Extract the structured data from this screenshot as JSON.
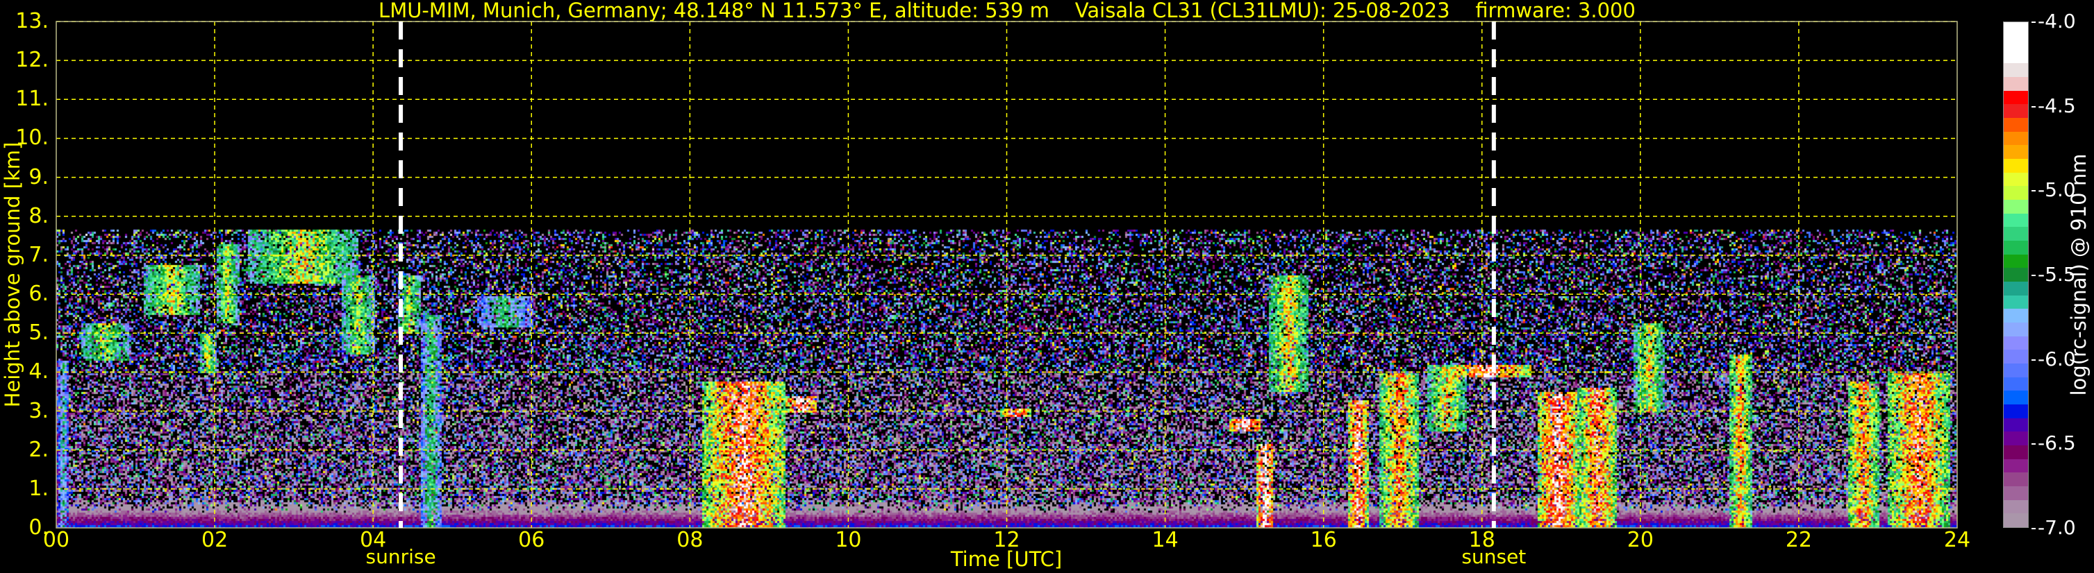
{
  "chart_data": {
    "type": "heatmap",
    "title": "LMU-MIM, Munich, Germany; 48.148° N 11.573° E, altitude: 539 m    Vaisala CL31 (CL31LMU): 25-08-2023    firmware: 3.000",
    "xlabel": "Time [UTC]",
    "ylabel": "Height above ground [km]",
    "xlim": [
      0,
      24
    ],
    "ylim": [
      0,
      13
    ],
    "x_ticks": [
      "00",
      "02",
      "04",
      "06",
      "08",
      "10",
      "12",
      "14",
      "16",
      "18",
      "20",
      "22",
      "24"
    ],
    "y_ticks": [
      "0.",
      "1.",
      "2.",
      "3.",
      "4.",
      "5.",
      "6.",
      "7.",
      "8.",
      "9.",
      "10.",
      "11.",
      "12.",
      "13."
    ],
    "grid": true,
    "annotations": [
      {
        "label": "sunrise",
        "time": 4.35
      },
      {
        "label": "sunset",
        "time": 18.15
      }
    ],
    "colorbar": {
      "label": "log(rc-signal) @ 910 nm",
      "range": [
        -7.0,
        -4.0
      ],
      "ticks": [
        "-4.0",
        "-4.5",
        "-5.0",
        "-5.5",
        "-6.0",
        "-6.5",
        "-7.0"
      ],
      "colors_bottom_to_top": [
        "#aa96aa",
        "#aa8caa",
        "#a0649b",
        "#96468c",
        "#8c1e8c",
        "#780064",
        "#6e0096",
        "#4b00b4",
        "#0014e6",
        "#0064ff",
        "#3c6eff",
        "#5a78ff",
        "#7882ff",
        "#8c8cff",
        "#8caaff",
        "#82beff",
        "#32c8aa",
        "#1ea58c",
        "#148c32",
        "#14a514",
        "#1ebe55",
        "#32d27d",
        "#46eb96",
        "#8cff78",
        "#c8ff3c",
        "#e6ff32",
        "#ffe600",
        "#ffaa00",
        "#ff8c00",
        "#ff5a00",
        "#f02020",
        "#ff0000",
        "#f0c3c3",
        "#ebe1e1",
        "#ffffff",
        "#ffffff",
        "#ffffff"
      ]
    },
    "signal_top_km": 7.7,
    "boundary_layer_km": 0.4,
    "features": [
      {
        "t0": 0.0,
        "t1": 0.15,
        "z0": 0.0,
        "z1": 4.3,
        "v": -5.6
      },
      {
        "t0": 0.3,
        "t1": 0.9,
        "z0": 4.3,
        "z1": 5.3,
        "v": -5.0
      },
      {
        "t0": 1.1,
        "t1": 1.8,
        "z0": 5.5,
        "z1": 6.8,
        "v": -4.9
      },
      {
        "t0": 1.8,
        "t1": 2.0,
        "z0": 4.0,
        "z1": 5.0,
        "v": -4.9
      },
      {
        "t0": 2.0,
        "t1": 2.3,
        "z0": 5.3,
        "z1": 7.3,
        "v": -5.0
      },
      {
        "t0": 2.4,
        "t1": 3.8,
        "z0": 6.3,
        "z1": 7.7,
        "v": -4.9
      },
      {
        "t0": 3.6,
        "t1": 4.0,
        "z0": 4.5,
        "z1": 6.5,
        "v": -5.0
      },
      {
        "t0": 4.3,
        "t1": 4.6,
        "z0": 5.0,
        "z1": 6.5,
        "v": -5.0
      },
      {
        "t0": 4.6,
        "t1": 4.85,
        "z0": 0.0,
        "z1": 5.5,
        "v": -5.3
      },
      {
        "t0": 5.3,
        "t1": 6.0,
        "z0": 5.2,
        "z1": 6.0,
        "v": -5.4
      },
      {
        "t0": 8.15,
        "t1": 9.2,
        "z0": 0.0,
        "z1": 3.8,
        "v": -4.4
      },
      {
        "t0": 9.2,
        "t1": 9.6,
        "z0": 3.0,
        "z1": 3.4,
        "v": -4.2
      },
      {
        "t0": 11.9,
        "t1": 12.3,
        "z0": 2.9,
        "z1": 3.1,
        "v": -4.3
      },
      {
        "t0": 14.8,
        "t1": 15.2,
        "z0": 2.5,
        "z1": 2.8,
        "v": -4.2
      },
      {
        "t0": 15.15,
        "t1": 15.35,
        "z0": 0.0,
        "z1": 2.2,
        "v": -4.1
      },
      {
        "t0": 15.3,
        "t1": 15.8,
        "z0": 3.5,
        "z1": 6.5,
        "v": -4.8
      },
      {
        "t0": 16.3,
        "t1": 16.55,
        "z0": 0.0,
        "z1": 3.3,
        "v": -4.3
      },
      {
        "t0": 16.7,
        "t1": 17.2,
        "z0": 0.0,
        "z1": 4.0,
        "v": -4.6
      },
      {
        "t0": 17.3,
        "t1": 17.8,
        "z0": 2.5,
        "z1": 4.2,
        "v": -4.8
      },
      {
        "t0": 17.5,
        "t1": 18.6,
        "z0": 3.9,
        "z1": 4.2,
        "v": -4.3
      },
      {
        "t0": 18.7,
        "t1": 19.2,
        "z0": 0.0,
        "z1": 3.5,
        "v": -4.3
      },
      {
        "t0": 19.2,
        "t1": 19.7,
        "z0": 0.0,
        "z1": 3.6,
        "v": -4.5
      },
      {
        "t0": 19.9,
        "t1": 20.3,
        "z0": 3.0,
        "z1": 5.3,
        "v": -4.9
      },
      {
        "t0": 21.1,
        "t1": 21.4,
        "z0": 0.0,
        "z1": 4.5,
        "v": -4.7
      },
      {
        "t0": 22.6,
        "t1": 23.0,
        "z0": 0.0,
        "z1": 3.8,
        "v": -4.6
      },
      {
        "t0": 23.1,
        "t1": 23.9,
        "z0": 0.0,
        "z1": 4.0,
        "v": -4.5
      }
    ]
  }
}
